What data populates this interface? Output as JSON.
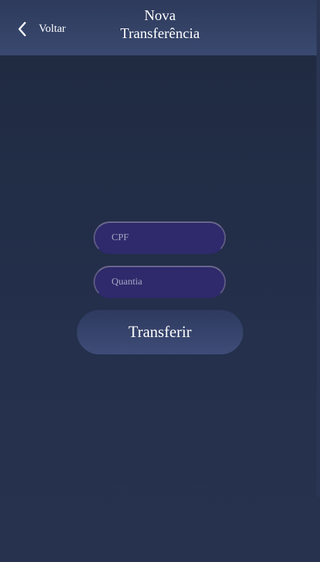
{
  "header": {
    "back_label": "Voltar",
    "back_icon": "chevron-left-icon",
    "title_line1": "Nova",
    "title_line2": "Transferência"
  },
  "form": {
    "cpf_placeholder": "CPF",
    "amount_placeholder": "Quantia",
    "submit_label": "Transferir"
  },
  "colors": {
    "background": "#1f2a40",
    "header": "#3a4970",
    "input_fill": "#2e2a6b",
    "button_fill": "#3e4c78"
  }
}
